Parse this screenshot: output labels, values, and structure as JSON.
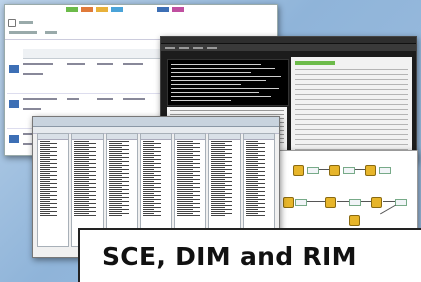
{
  "caption": {
    "text": "SCE, DIM and RIM"
  },
  "colors": {
    "background": "#9ebee0",
    "console_bg": "#1c1c1c",
    "node_fill": "#e7b52a",
    "status_green": "#6cbb4a",
    "thumb_blue": "#3d6fb5",
    "tab_colors": [
      "#6cbb4a",
      "#e07a3a",
      "#e8b13a",
      "#4aa3d8",
      "#3d6fb5",
      "#c04fa0"
    ]
  },
  "icons": {
    "app_icon": "window-icon",
    "flow_node": "process-node-icon"
  }
}
